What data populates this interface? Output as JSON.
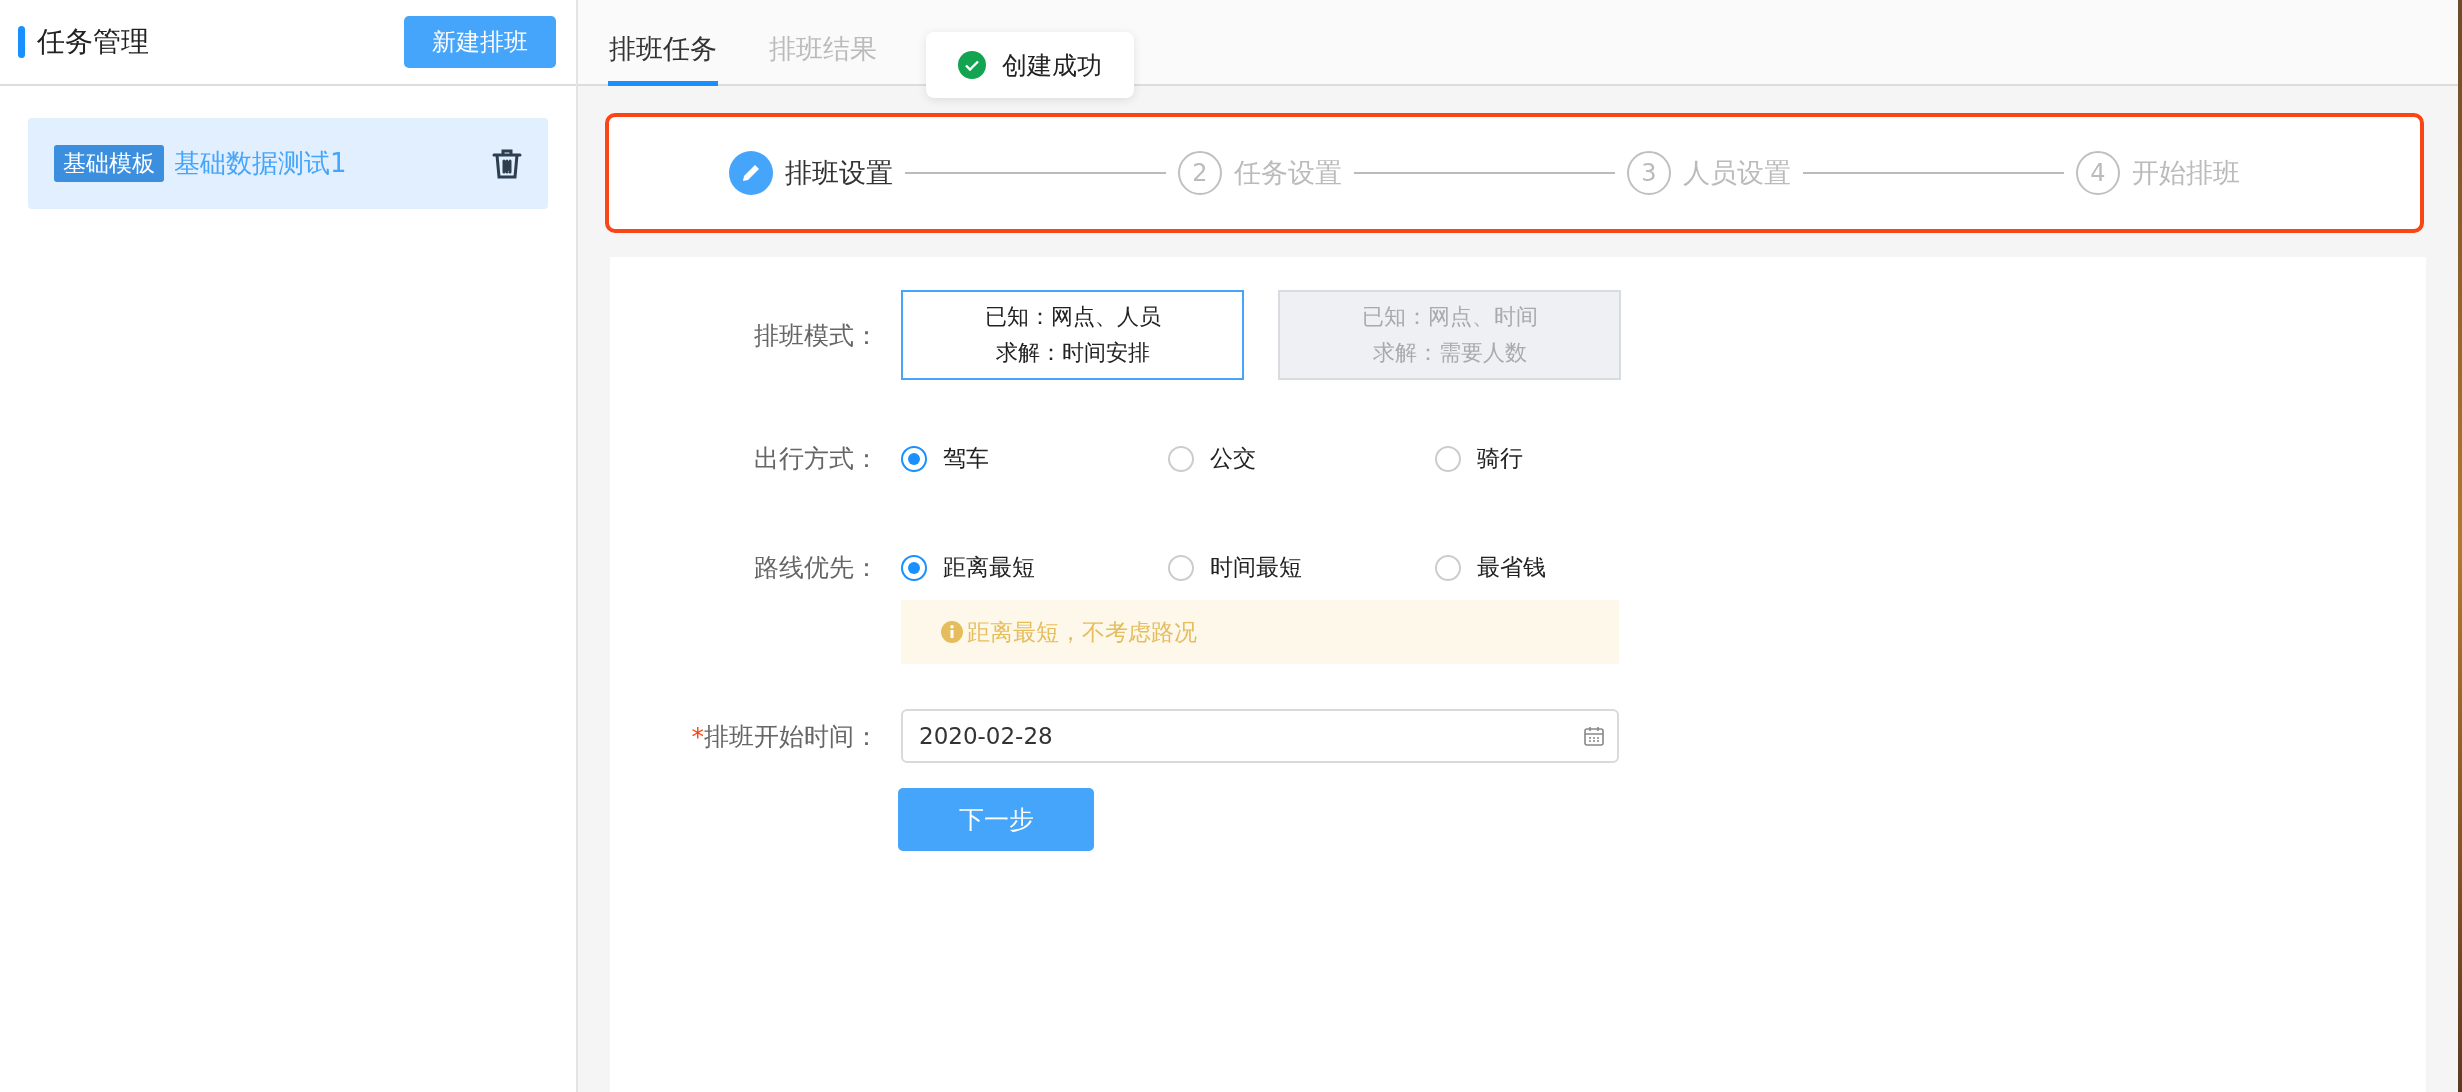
{
  "sidebar": {
    "title": "任务管理",
    "new_button": "新建排班",
    "items": [
      {
        "tag": "基础模板",
        "name": "基础数据测试1",
        "selected": true
      }
    ]
  },
  "tabs": [
    {
      "label": "排班任务",
      "selected": true
    },
    {
      "label": "排班结果",
      "selected": false
    }
  ],
  "toast": {
    "kind": "success",
    "text": "创建成功"
  },
  "steps": [
    {
      "label": "排班设置",
      "active": true
    },
    {
      "number": "2",
      "label": "任务设置",
      "active": false
    },
    {
      "number": "3",
      "label": "人员设置",
      "active": false
    },
    {
      "number": "4",
      "label": "开始排班",
      "active": false
    }
  ],
  "form": {
    "mode": {
      "label": "排班模式：",
      "options": [
        {
          "lines": [
            "已知：网点、人员",
            "求解：时间安排"
          ],
          "selected": true
        },
        {
          "lines": [
            "已知：网点、时间",
            "求解：需要人数"
          ],
          "selected": false
        }
      ]
    },
    "travel": {
      "label": "出行方式：",
      "options": [
        {
          "label": "驾车",
          "selected": true
        },
        {
          "label": "公交",
          "selected": false
        },
        {
          "label": "骑行",
          "selected": false
        }
      ]
    },
    "route": {
      "label": "路线优先：",
      "options": [
        {
          "label": "距离最短",
          "selected": true
        },
        {
          "label": "时间最短",
          "selected": false
        },
        {
          "label": "最省钱",
          "selected": false
        }
      ],
      "tip": "距离最短，不考虑路况"
    },
    "start_time": {
      "required_mark": "*",
      "label": "排班开始时间：",
      "value": "2020-02-28"
    },
    "next_button": "下一步"
  }
}
